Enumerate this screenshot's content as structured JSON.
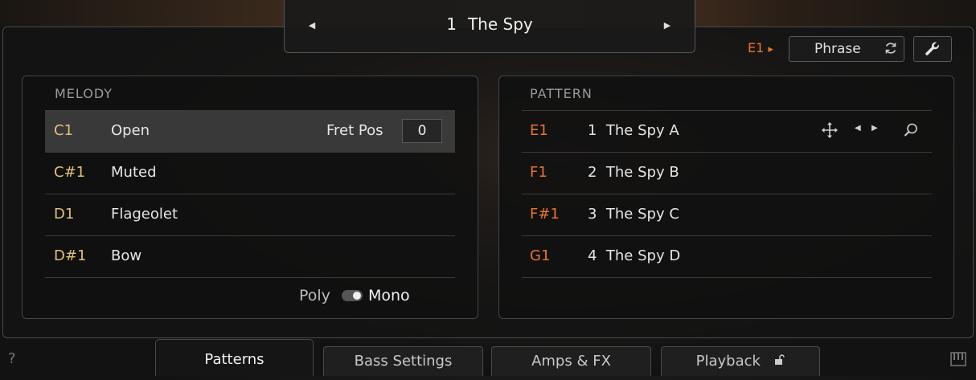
{
  "preset": {
    "prev_icon": "◀",
    "number": "1",
    "name": "The Spy",
    "next_icon": "▶"
  },
  "top_controls": {
    "key": "E1",
    "key_arrow": "▸",
    "phrase_label": "Phrase",
    "phrase_icon": "sync-icon",
    "settings_icon": "wrench-icon"
  },
  "melody": {
    "title": "MELODY",
    "rows": [
      {
        "note": "C1",
        "articulation": "Open"
      },
      {
        "note": "C#1",
        "articulation": "Muted"
      },
      {
        "note": "D1",
        "articulation": "Flageolet"
      },
      {
        "note": "D#1",
        "articulation": "Bow"
      }
    ],
    "fret_pos_label": "Fret Pos",
    "fret_pos_value": "0",
    "poly_label": "Poly",
    "mono_label": "Mono"
  },
  "pattern": {
    "title": "PATTERN",
    "rows": [
      {
        "note": "E1",
        "name": "1  The Spy A"
      },
      {
        "note": "F1",
        "name": "2  The Spy B"
      },
      {
        "note": "F#1",
        "name": "3  The Spy C"
      },
      {
        "note": "G1",
        "name": "4  The Spy D"
      }
    ]
  },
  "tabs": [
    {
      "label": "Patterns",
      "active": true
    },
    {
      "label": "Bass Settings",
      "active": false
    },
    {
      "label": "Amps & FX",
      "active": false
    },
    {
      "label": "Playback",
      "active": false
    }
  ],
  "footer": {
    "help": "?",
    "keyboard_icon": "piano-keys-icon"
  },
  "colors": {
    "accent_orange": "#e8742c",
    "note_gold": "#e0c07a",
    "panel_bg": "#141414"
  }
}
